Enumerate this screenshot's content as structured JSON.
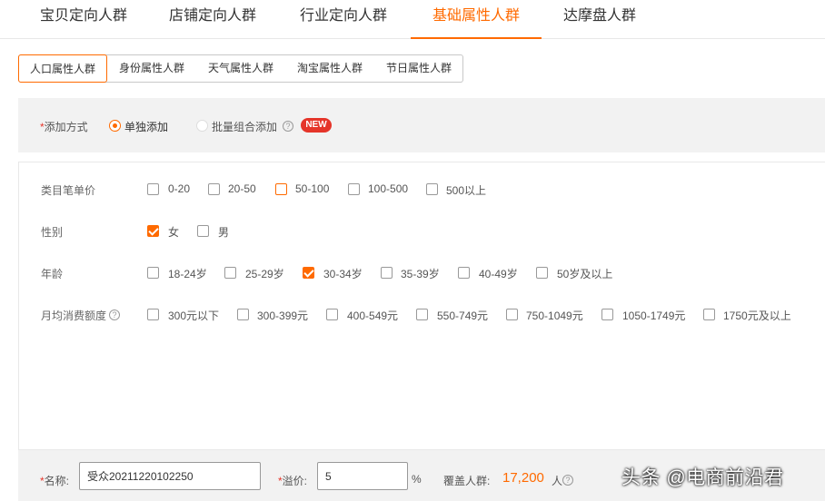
{
  "top_tabs": [
    "宝贝定向人群",
    "店铺定向人群",
    "行业定向人群",
    "基础属性人群",
    "达摩盘人群"
  ],
  "sub_tabs": [
    "人口属性人群",
    "身份属性人群",
    "天气属性人群",
    "淘宝属性人群",
    "节日属性人群"
  ],
  "add_method": {
    "required_mark": "*",
    "label": "添加方式",
    "options": [
      "单独添加",
      "批量组合添加"
    ],
    "selected": "单独添加",
    "help": "?",
    "new_badge": "NEW"
  },
  "attributes": {
    "price": {
      "label": "类目笔单价",
      "options": [
        "0-20",
        "20-50",
        "50-100",
        "100-500",
        "500以上"
      ],
      "checked": []
    },
    "gender": {
      "label": "性别",
      "options": [
        "女",
        "男"
      ],
      "checked": [
        "女"
      ]
    },
    "age": {
      "label": "年龄",
      "options": [
        "18-24岁",
        "25-29岁",
        "30-34岁",
        "35-39岁",
        "40-49岁",
        "50岁及以上"
      ],
      "checked": [
        "30-34岁"
      ]
    },
    "spend": {
      "label": "月均消费额度",
      "help": "?",
      "options": [
        "300元以下",
        "300-399元",
        "400-549元",
        "550-749元",
        "750-1049元",
        "1050-1749元",
        "1750元及以上"
      ],
      "checked": []
    }
  },
  "bottom": {
    "name_required": "*",
    "name_label": "名称:",
    "name_value": "受众20211220102250",
    "premium_required": "*",
    "premium_label": "溢价:",
    "premium_value": "5",
    "premium_unit": "%",
    "coverage_label": "覆盖人群:",
    "coverage_value": "17,200",
    "coverage_unit": "人",
    "help": "?"
  },
  "watermark": "头条 @电商前沿君",
  "colors": {
    "accent": "#ff6a00",
    "required": "#e5352a",
    "badge": "#e5352a"
  }
}
